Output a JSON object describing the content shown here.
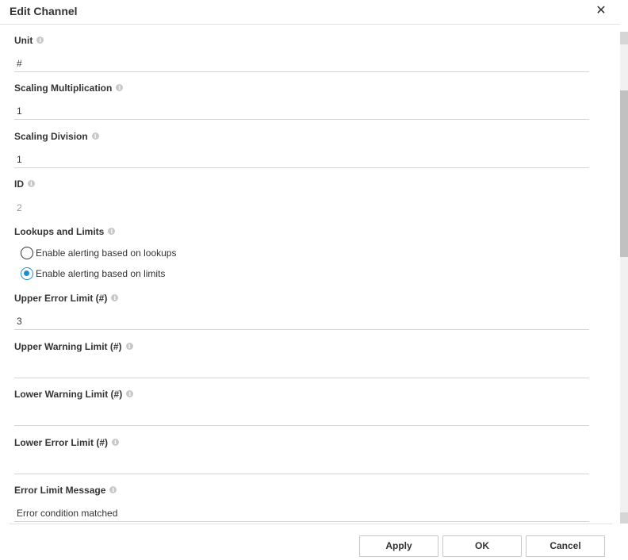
{
  "dialog": {
    "title": "Edit Channel",
    "close_glyph": "✕"
  },
  "fields": [
    {
      "label": "Unit",
      "value": "#"
    },
    {
      "label": "Scaling Multiplication",
      "value": "1"
    },
    {
      "label": "Scaling Division",
      "value": "1"
    },
    {
      "label": "ID",
      "value": "2",
      "readonly": true
    },
    {
      "label": "Upper Error Limit (#)",
      "value": "3"
    },
    {
      "label": "Upper Warning Limit (#)",
      "value": ""
    },
    {
      "label": "Lower Warning Limit (#)",
      "value": ""
    },
    {
      "label": "Lower Error Limit (#)",
      "value": ""
    },
    {
      "label": "Error Limit Message",
      "value": "Error condition matched"
    }
  ],
  "lookups": {
    "label": "Lookups and Limits",
    "options": [
      {
        "label": "Enable alerting based on lookups",
        "checked": false
      },
      {
        "label": "Enable alerting based on limits",
        "checked": true
      }
    ]
  },
  "icons": {
    "info": "info-icon",
    "info_glyph": "i"
  },
  "buttons": {
    "apply": "Apply",
    "ok": "OK",
    "cancel": "Cancel"
  },
  "colors": {
    "accent": "#1a8fd0",
    "border": "#d4d4d4",
    "text": "#333333",
    "muted": "#9b9b9b"
  }
}
